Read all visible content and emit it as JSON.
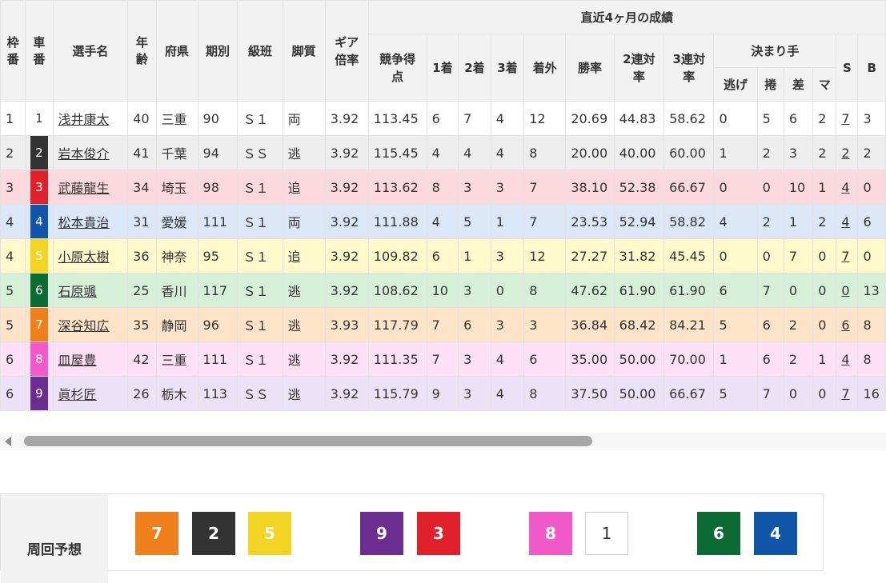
{
  "header": {
    "waku": "枠番",
    "sha": "車番",
    "name": "選手名",
    "age": "年齢",
    "pref": "府県",
    "term": "期別",
    "class": "級班",
    "leg": "脚質",
    "gear": "ギア倍率",
    "recent": "直近4ヶ月の成績",
    "score": "競争得点",
    "first": "1着",
    "second": "2着",
    "third": "3着",
    "outside": "着外",
    "win_rate": "勝率",
    "rate2": "2連対率",
    "rate3": "3連対率",
    "kimarite": "決まり手",
    "nige": "逃げ",
    "makuri": "捲",
    "sashi": "差",
    "mark": "マ",
    "s": "S",
    "b": "B"
  },
  "racers": [
    {
      "waku": "1",
      "sha": "1",
      "name": "浅井康太",
      "age": "40",
      "pref": "三重",
      "term": "90",
      "cls": "Ｓ１",
      "leg": "両",
      "gear": "3.92",
      "score": "113.45",
      "f1": "6",
      "f2": "7",
      "f3": "4",
      "fo": "12",
      "win": "20.69",
      "r2": "44.83",
      "r3": "58.62",
      "nige": "0",
      "makuri": "5",
      "sashi": "6",
      "mark": "2",
      "s": "7",
      "b": "3"
    },
    {
      "waku": "2",
      "sha": "2",
      "name": "岩本俊介",
      "age": "41",
      "pref": "千葉",
      "term": "94",
      "cls": "ＳＳ",
      "leg": "逃",
      "gear": "3.92",
      "score": "115.45",
      "f1": "4",
      "f2": "4",
      "f3": "4",
      "fo": "8",
      "win": "20.00",
      "r2": "40.00",
      "r3": "60.00",
      "nige": "1",
      "makuri": "2",
      "sashi": "3",
      "mark": "2",
      "s": "2",
      "b": "2"
    },
    {
      "waku": "3",
      "sha": "3",
      "name": "武藤龍生",
      "age": "34",
      "pref": "埼玉",
      "term": "98",
      "cls": "Ｓ１",
      "leg": "追",
      "gear": "3.92",
      "score": "113.62",
      "f1": "8",
      "f2": "3",
      "f3": "3",
      "fo": "7",
      "win": "38.10",
      "r2": "52.38",
      "r3": "66.67",
      "nige": "0",
      "makuri": "0",
      "sashi": "10",
      "mark": "1",
      "s": "4",
      "b": "0"
    },
    {
      "waku": "4",
      "sha": "4",
      "name": "松本貴治",
      "age": "31",
      "pref": "愛媛",
      "term": "111",
      "cls": "Ｓ１",
      "leg": "両",
      "gear": "3.92",
      "score": "111.88",
      "f1": "4",
      "f2": "5",
      "f3": "1",
      "fo": "7",
      "win": "23.53",
      "r2": "52.94",
      "r3": "58.82",
      "nige": "4",
      "makuri": "2",
      "sashi": "1",
      "mark": "2",
      "s": "4",
      "b": "6"
    },
    {
      "waku": "4",
      "sha": "5",
      "name": "小原太樹",
      "age": "36",
      "pref": "神奈",
      "term": "95",
      "cls": "Ｓ１",
      "leg": "追",
      "gear": "3.92",
      "score": "109.82",
      "f1": "6",
      "f2": "1",
      "f3": "3",
      "fo": "12",
      "win": "27.27",
      "r2": "31.82",
      "r3": "45.45",
      "nige": "0",
      "makuri": "0",
      "sashi": "7",
      "mark": "0",
      "s": "7",
      "b": "0"
    },
    {
      "waku": "5",
      "sha": "6",
      "name": "石原颯",
      "age": "25",
      "pref": "香川",
      "term": "117",
      "cls": "Ｓ１",
      "leg": "逃",
      "gear": "3.92",
      "score": "108.62",
      "f1": "10",
      "f2": "3",
      "f3": "0",
      "fo": "8",
      "win": "47.62",
      "r2": "61.90",
      "r3": "61.90",
      "nige": "6",
      "makuri": "7",
      "sashi": "0",
      "mark": "0",
      "s": "0",
      "b": "13"
    },
    {
      "waku": "5",
      "sha": "7",
      "name": "深谷知広",
      "age": "35",
      "pref": "静岡",
      "term": "96",
      "cls": "Ｓ１",
      "leg": "逃",
      "gear": "3.93",
      "score": "117.79",
      "f1": "7",
      "f2": "6",
      "f3": "3",
      "fo": "3",
      "win": "36.84",
      "r2": "68.42",
      "r3": "84.21",
      "nige": "5",
      "makuri": "6",
      "sashi": "2",
      "mark": "0",
      "s": "6",
      "b": "8"
    },
    {
      "waku": "6",
      "sha": "8",
      "name": "皿屋豊",
      "age": "42",
      "pref": "三重",
      "term": "111",
      "cls": "Ｓ１",
      "leg": "逃",
      "gear": "3.92",
      "score": "111.35",
      "f1": "7",
      "f2": "3",
      "f3": "4",
      "fo": "6",
      "win": "35.00",
      "r2": "50.00",
      "r3": "70.00",
      "nige": "1",
      "makuri": "6",
      "sashi": "2",
      "mark": "1",
      "s": "4",
      "b": "8"
    },
    {
      "waku": "6",
      "sha": "9",
      "name": "眞杉匠",
      "age": "26",
      "pref": "栃木",
      "term": "113",
      "cls": "ＳＳ",
      "leg": "逃",
      "gear": "3.92",
      "score": "115.79",
      "f1": "9",
      "f2": "3",
      "f3": "4",
      "fo": "8",
      "win": "37.50",
      "r2": "50.00",
      "r3": "66.67",
      "nige": "5",
      "makuri": "7",
      "sashi": "0",
      "mark": "0",
      "s": "7",
      "b": "16"
    }
  ],
  "car_colors": {
    "1": {
      "bg": "#ffffff",
      "fg": "#333333",
      "row": "#ffffff"
    },
    "2": {
      "bg": "#333333",
      "fg": "#ffffff",
      "row": "#eeeeee"
    },
    "3": {
      "bg": "#e0202a",
      "fg": "#ffffff",
      "row": "#fcd9df"
    },
    "4": {
      "bg": "#1155a8",
      "fg": "#ffffff",
      "row": "#dbe7f6"
    },
    "5": {
      "bg": "#f2d422",
      "fg": "#ffffff",
      "row": "#fff9cc"
    },
    "6": {
      "bg": "#0b6b33",
      "fg": "#ffffff",
      "row": "#d6efd8"
    },
    "7": {
      "bg": "#ef7f1a",
      "fg": "#ffffff",
      "row": "#fde3c8"
    },
    "8": {
      "bg": "#f25aca",
      "fg": "#ffffff",
      "row": "#fde0f4"
    },
    "9": {
      "bg": "#6b2d90",
      "fg": "#ffffff",
      "row": "#ece2f7"
    }
  },
  "prediction": {
    "label": "周回予想",
    "order": [
      "7",
      "2",
      "5",
      "9",
      "3",
      "8",
      "1",
      "6",
      "4"
    ]
  }
}
